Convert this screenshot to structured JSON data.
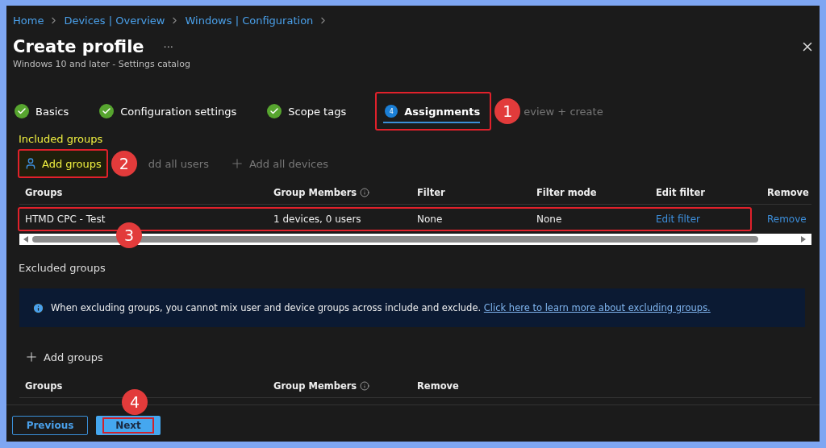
{
  "breadcrumb": [
    "Home",
    "Devices | Overview",
    "Windows | Configuration"
  ],
  "title": "Create profile",
  "more": "···",
  "subtitle": "Windows 10 and later - Settings catalog",
  "steps": [
    {
      "label": "Basics",
      "done": true,
      "selected": false,
      "highlighted": false
    },
    {
      "label": "Configuration settings",
      "done": true,
      "selected": false,
      "highlighted": false
    },
    {
      "label": "Scope tags",
      "done": true,
      "selected": false,
      "highlighted": false
    },
    {
      "label": "Assignments",
      "done": false,
      "number": "4",
      "selected": true,
      "highlighted": true,
      "callout": "1"
    },
    {
      "label": "eview + create",
      "done": false,
      "selected": false,
      "highlighted": false
    }
  ],
  "included": {
    "heading": "Included groups",
    "actions": [
      {
        "label": "Add groups",
        "kind": "picker",
        "disabled": false,
        "highlighted": true,
        "callout": "2"
      },
      {
        "label": "dd all users",
        "kind": "covered",
        "disabled": true,
        "highlighted": false
      },
      {
        "label": "Add all devices",
        "kind": "adder",
        "disabled": true,
        "highlighted": false
      }
    ],
    "columns": [
      {
        "label": "Groups",
        "info": false
      },
      {
        "label": "Group Members",
        "info": true
      },
      {
        "label": "Filter",
        "info": false
      },
      {
        "label": "Filter mode",
        "info": false
      },
      {
        "label": "Edit filter",
        "info": false
      },
      {
        "label": "Remove",
        "info": false
      }
    ],
    "rows": [
      {
        "highlighted": true,
        "callout": "3",
        "cells": [
          {
            "kind": "text",
            "text": "HTMD CPC - Test"
          },
          {
            "kind": "text",
            "text": "1 devices, 0 users"
          },
          {
            "kind": "text",
            "text": "None"
          },
          {
            "kind": "text",
            "text": "None"
          },
          {
            "kind": "link",
            "text": "Edit filter"
          },
          {
            "kind": "link",
            "text": "Remove"
          }
        ]
      }
    ]
  },
  "excluded": {
    "heading": "Excluded groups",
    "banner": {
      "text": "When excluding groups, you cannot mix user and device groups across include and exclude.",
      "link": "Click here to learn more about excluding groups."
    },
    "actions": [
      {
        "label": "Add groups",
        "kind": "adder",
        "disabled": false,
        "highlighted": false
      }
    ],
    "columns": [
      {
        "label": "Groups",
        "info": false
      },
      {
        "label": "Group Members",
        "info": true
      },
      {
        "label": "Remove",
        "info": false
      }
    ]
  },
  "footer": [
    {
      "label": "Previous",
      "kind": "secondary",
      "highlighted": false
    },
    {
      "label": "Next",
      "kind": "primary",
      "highlighted": true,
      "callout": "4"
    }
  ]
}
